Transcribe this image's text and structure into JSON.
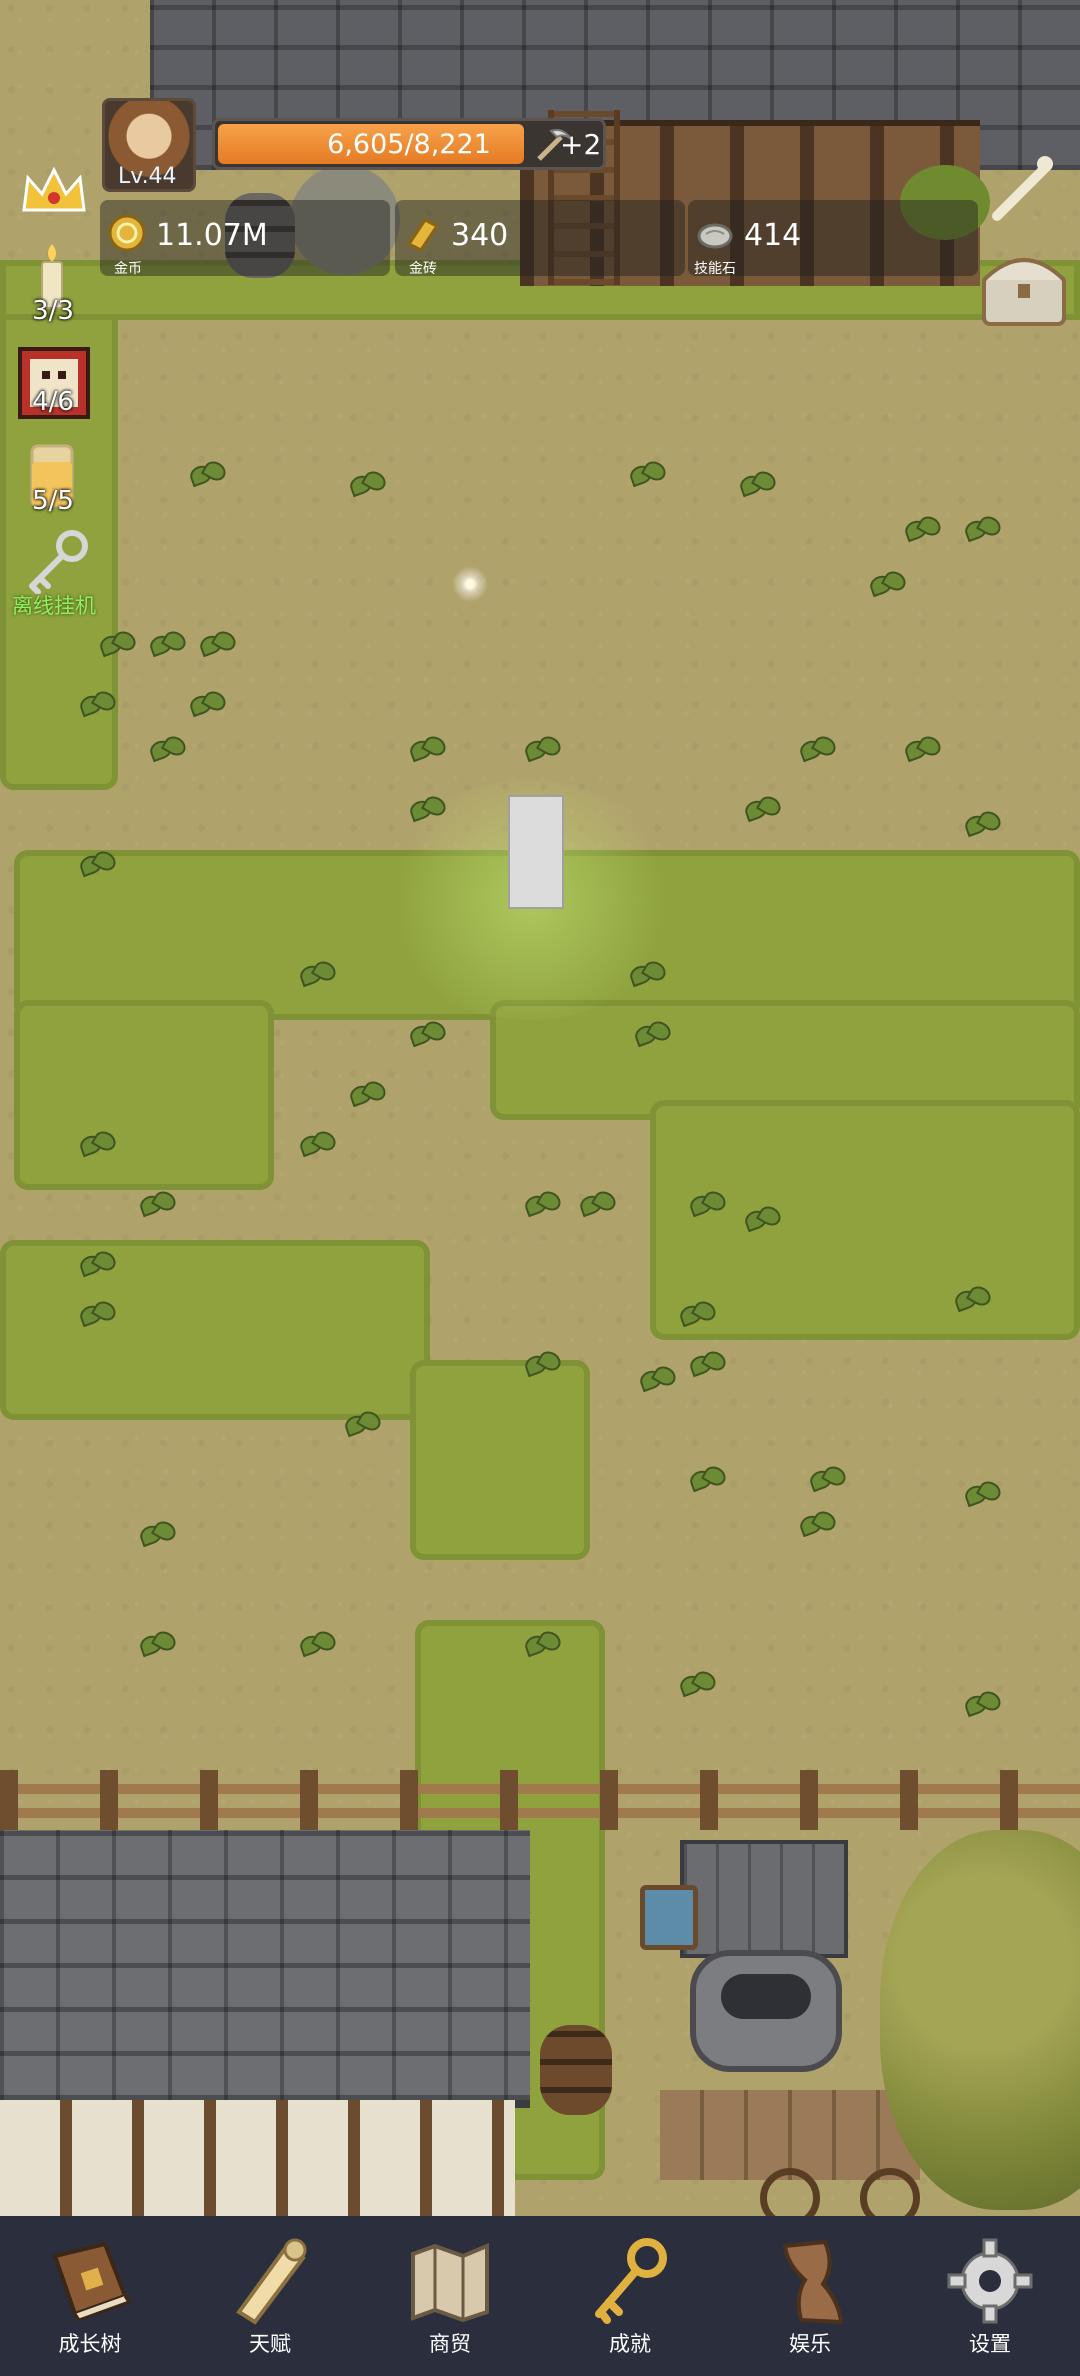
{
  "player": {
    "level": "Lv.44",
    "hp_text": "6,605/8,221",
    "hp_fraction": 0.803,
    "pickaxe_bonus": "+2"
  },
  "resources": [
    {
      "value": "11.07M",
      "label": "金币",
      "icon": "gold-coin-icon"
    },
    {
      "value": "340",
      "label": "金砖",
      "icon": "gold-brick-icon"
    },
    {
      "value": "414",
      "label": "技能石",
      "icon": "skill-stone-icon"
    }
  ],
  "side_counters": {
    "candle": "3/3",
    "scroll": "4/6",
    "beer": "5/5",
    "offline_label": "离线挂机"
  },
  "nav": [
    {
      "label": "成长树",
      "icon": "book-icon"
    },
    {
      "label": "天赋",
      "icon": "scroll-icon"
    },
    {
      "label": "商贸",
      "icon": "map-icon"
    },
    {
      "label": "成就",
      "icon": "key-icon"
    },
    {
      "label": "娱乐",
      "icon": "parchment-icon"
    },
    {
      "label": "设置",
      "icon": "gear-icon"
    }
  ],
  "colors": {
    "hp_fill": "#e57b24",
    "nav_bg": "#2b2f3d",
    "offline_label": "#8ff05a"
  }
}
